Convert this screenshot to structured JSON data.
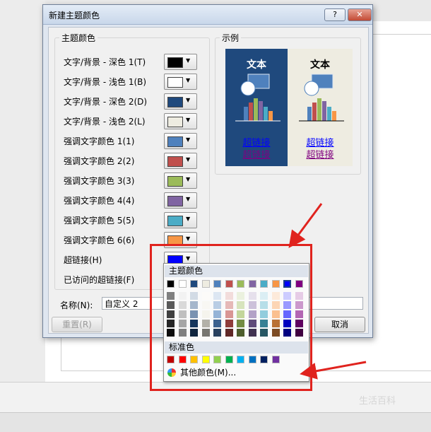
{
  "dialog": {
    "title": "新建主题颜色",
    "help_label": "?",
    "close_label": "✕"
  },
  "theme_colors": {
    "group_title": "主题颜色",
    "rows": [
      {
        "label": "文字/背景 - 深色 1(T)",
        "color": "#000000"
      },
      {
        "label": "文字/背景 - 浅色 1(B)",
        "color": "#ffffff"
      },
      {
        "label": "文字/背景 - 深色 2(D)",
        "color": "#1f497d"
      },
      {
        "label": "文字/背景 - 浅色 2(L)",
        "color": "#eeece1"
      },
      {
        "label": "强调文字颜色 1(1)",
        "color": "#4f81bd"
      },
      {
        "label": "强调文字颜色 2(2)",
        "color": "#c0504d"
      },
      {
        "label": "强调文字颜色 3(3)",
        "color": "#9bbb59"
      },
      {
        "label": "强调文字颜色 4(4)",
        "color": "#8064a2"
      },
      {
        "label": "强调文字颜色 5(5)",
        "color": "#4bacc6"
      },
      {
        "label": "强调文字颜色 6(6)",
        "color": "#f79646"
      },
      {
        "label": "超链接(H)",
        "color": "#0000ff"
      },
      {
        "label": "已访问的超链接(F)",
        "color": ""
      }
    ]
  },
  "sample": {
    "group_title": "示例",
    "text_label": "文本",
    "hyperlink_label": "超链接",
    "visited_label": "超链接"
  },
  "name_field": {
    "label": "名称(N):",
    "value": "自定义 2"
  },
  "buttons": {
    "reset_label": "重置(R)",
    "cancel_label": "取消"
  },
  "color_picker": {
    "theme_header": "主题颜色",
    "standard_header": "标准色",
    "more_colors_label": "其他颜色(M)...",
    "theme_top_row": [
      "#000000",
      "#ffffff",
      "#1f497d",
      "#eeece1",
      "#4f81bd",
      "#c0504d",
      "#9bbb59",
      "#8064a2",
      "#4bacc6",
      "#f79646",
      "#0000ff",
      "#800080"
    ],
    "selected_index": 10,
    "standard_colors": [
      "#c00000",
      "#ff0000",
      "#ffc000",
      "#ffff00",
      "#92d050",
      "#00b050",
      "#00b0f0",
      "#0070c0",
      "#002060",
      "#7030a0"
    ]
  },
  "watermark": "生活百科"
}
